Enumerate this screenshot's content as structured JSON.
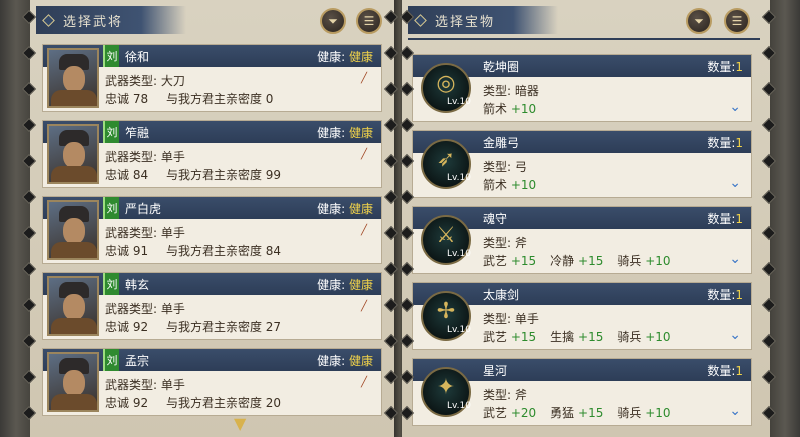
{
  "left_panel": {
    "title": "选择武将",
    "filter_icon": "filter-icon",
    "list_icon": "list-icon",
    "generals": [
      {
        "name": "徐和",
        "faction": "刘",
        "health_label": "健康:",
        "health": "健康",
        "weapon_type_label": "武器类型:",
        "weapon_type": "大刀",
        "loyalty_label": "忠诚",
        "loyalty": "78",
        "intimacy_label": "与我方君主亲密度",
        "intimacy": "0"
      },
      {
        "name": "笮融",
        "faction": "刘",
        "health_label": "健康:",
        "health": "健康",
        "weapon_type_label": "武器类型:",
        "weapon_type": "单手",
        "loyalty_label": "忠诚",
        "loyalty": "84",
        "intimacy_label": "与我方君主亲密度",
        "intimacy": "99"
      },
      {
        "name": "严白虎",
        "faction": "刘",
        "health_label": "健康:",
        "health": "健康",
        "weapon_type_label": "武器类型:",
        "weapon_type": "单手",
        "loyalty_label": "忠诚",
        "loyalty": "91",
        "intimacy_label": "与我方君主亲密度",
        "intimacy": "84"
      },
      {
        "name": "韩玄",
        "faction": "刘",
        "health_label": "健康:",
        "health": "健康",
        "weapon_type_label": "武器类型:",
        "weapon_type": "单手",
        "loyalty_label": "忠诚",
        "loyalty": "92",
        "intimacy_label": "与我方君主亲密度",
        "intimacy": "27"
      },
      {
        "name": "孟宗",
        "faction": "刘",
        "health_label": "健康:",
        "health": "健康",
        "weapon_type_label": "武器类型:",
        "weapon_type": "单手",
        "loyalty_label": "忠诚",
        "loyalty": "92",
        "intimacy_label": "与我方君主亲密度",
        "intimacy": "20"
      }
    ]
  },
  "right_panel": {
    "title": "选择宝物",
    "filter_icon": "filter-icon",
    "list_icon": "list-icon",
    "treasures": [
      {
        "name": "乾坤圈",
        "qty_label": "数量:",
        "qty": "1",
        "level": "Lv.10",
        "type_label": "类型:",
        "type": "暗器",
        "stats": [
          {
            "k": "箭术",
            "v": "+10"
          }
        ]
      },
      {
        "name": "金雕弓",
        "qty_label": "数量:",
        "qty": "1",
        "level": "Lv.10",
        "type_label": "类型:",
        "type": "弓",
        "stats": [
          {
            "k": "箭术",
            "v": "+10"
          }
        ]
      },
      {
        "name": "魂守",
        "qty_label": "数量:",
        "qty": "1",
        "level": "Lv.10",
        "type_label": "类型:",
        "type": "斧",
        "stats": [
          {
            "k": "武艺",
            "v": "+15"
          },
          {
            "k": "冷静",
            "v": "+15"
          },
          {
            "k": "骑兵",
            "v": "+10"
          }
        ]
      },
      {
        "name": "太康剑",
        "qty_label": "数量:",
        "qty": "1",
        "level": "Lv.10",
        "type_label": "类型:",
        "type": "单手",
        "stats": [
          {
            "k": "武艺",
            "v": "+15"
          },
          {
            "k": "生擒",
            "v": "+15"
          },
          {
            "k": "骑兵",
            "v": "+10"
          }
        ]
      },
      {
        "name": "星河",
        "qty_label": "数量:",
        "qty": "1",
        "level": "Lv.10",
        "type_label": "类型:",
        "type": "斧",
        "stats": [
          {
            "k": "武艺",
            "v": "+20"
          },
          {
            "k": "勇猛",
            "v": "+15"
          },
          {
            "k": "骑兵",
            "v": "+10"
          }
        ]
      }
    ]
  },
  "colors": {
    "health": "#f0d24a",
    "bonus": "#2d8b2d",
    "header": "#2f3e57",
    "card_bg": "#f2ede2"
  }
}
